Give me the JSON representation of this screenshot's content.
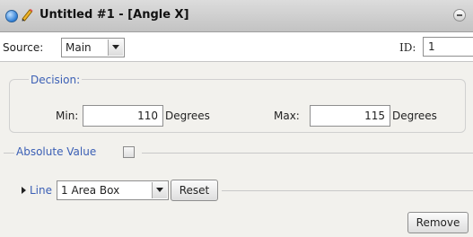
{
  "window": {
    "title": "Untitled #1 - [Angle X]",
    "icons": [
      "circle-status-icon",
      "pencil-icon",
      "collapse-icon"
    ]
  },
  "source": {
    "label": "Source:",
    "selected": "Main",
    "id_label": "ID:",
    "id_value": "1"
  },
  "decision": {
    "legend": "Decision:",
    "min_label": "Min:",
    "min_value": "110",
    "min_unit": "Degrees",
    "max_label": "Max:",
    "max_value": "115",
    "max_unit": "Degrees"
  },
  "absolute": {
    "label": "Absolute Value",
    "checked": false
  },
  "line": {
    "label": "Line",
    "selected": "1 Area Box",
    "reset_label": "Reset"
  },
  "footer": {
    "remove_label": "Remove"
  },
  "colors": {
    "accent_text": "#3b5fb5",
    "panel_bg": "#f2f1ed"
  }
}
